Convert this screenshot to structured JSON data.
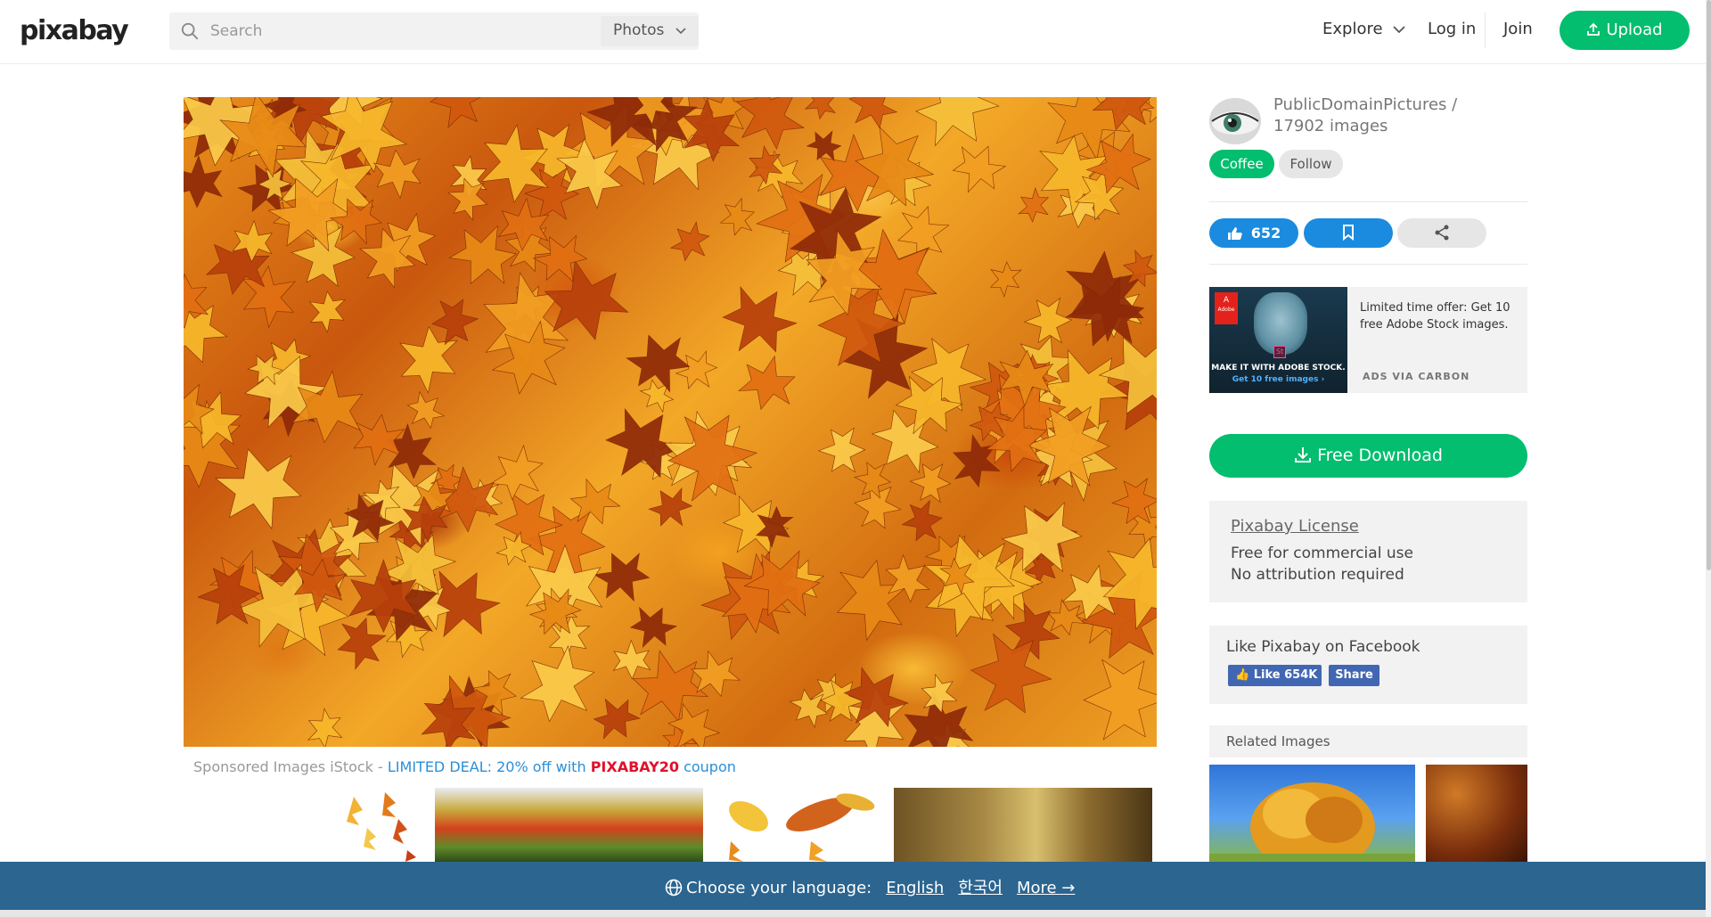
{
  "header": {
    "logo": "pixabay",
    "search_placeholder": "Search",
    "search_type": "Photos",
    "explore": "Explore",
    "login": "Log in",
    "join": "Join",
    "upload": "Upload",
    "brand_color": "#02be6e"
  },
  "author": {
    "name_line": "PublicDomainPictures / 17902 images",
    "coffee": "Coffee",
    "follow": "Follow"
  },
  "actions": {
    "likes": "652"
  },
  "ad": {
    "text": "Limited time offer: Get 10 free Adobe Stock images.",
    "via": "ADS VIA CARBON",
    "image_line1": "MAKE IT WITH ADOBE STOCK.",
    "image_line2": "Get 10 free images ›",
    "logo_text": "Adobe",
    "badge": "St"
  },
  "download": {
    "label": "Free Download"
  },
  "license": {
    "title": "Pixabay License",
    "line1": "Free for commercial use",
    "line2": "No attribution required"
  },
  "facebook": {
    "title": "Like Pixabay on Facebook",
    "like": "Like 654K",
    "share": "Share"
  },
  "related": {
    "title": "Related Images"
  },
  "sponsored": {
    "prefix": "Sponsored Images iStock - ",
    "deal": "LIMITED DEAL: 20% off with ",
    "code": "PIXABAY20",
    "suffix": " coupon"
  },
  "language_bar": {
    "label": "Choose your language:",
    "english": "English",
    "korean": "한국어",
    "more": "More →"
  },
  "icons": {
    "search": "search-icon",
    "chevron": "chevron-down-icon",
    "upload": "upload-icon",
    "like": "thumbs-up-icon",
    "bookmark": "bookmark-icon",
    "share": "share-icon",
    "download": "download-icon",
    "globe": "globe-icon"
  }
}
